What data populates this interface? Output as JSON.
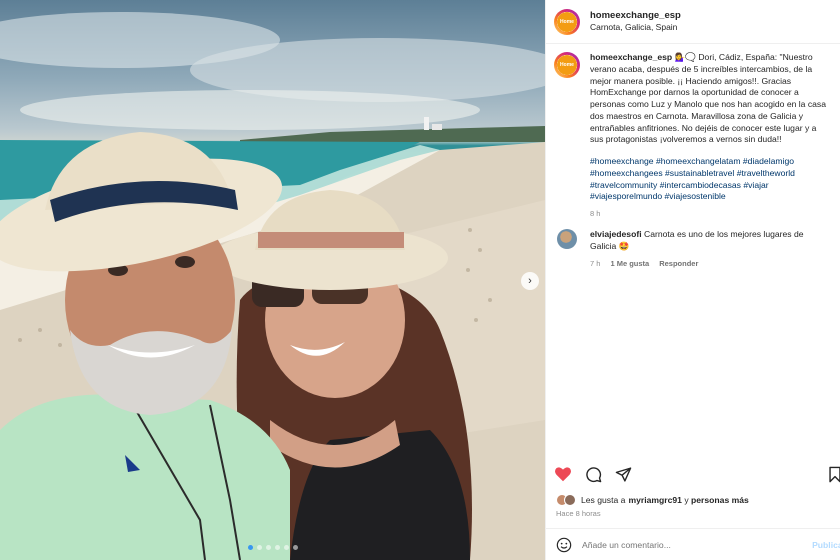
{
  "post": {
    "username": "homeexchange_esp",
    "location": "Carnota, Galicia, Spain",
    "avatar_text": "Home",
    "caption_username": "homeexchange_esp",
    "caption_emoji": "💁‍♀️🗨️",
    "caption_text": " Dori, Cádiz, España: \"Nuestro verano acaba, después de 5 increíbles intercambios, de la mejor manera posible. ¡¡ Haciendo amigos!!. Gracias HomExchange por darnos la oportunidad de conocer a personas como Luz y Manolo que nos han acogido en la casa dos maestros en Carnota. Maravillosa zona de Galicia y entrañables anfitriones. No dejéis de conocer este lugar y a sus protagonistas ¡volveremos a vernos sin duda!!",
    "hashtags": [
      "#homeexchange",
      "#homeexchangelatam",
      "#diadelamigo",
      "#homeexchangees",
      "#sustainabletravel",
      "#traveltheworld",
      "#travelcommunity",
      "#intercambiodecasas",
      "#viajar",
      "#viajesporelmundo",
      "#viajesostenible"
    ],
    "caption_time": "8 h"
  },
  "comments": [
    {
      "username": "elviajedesofi",
      "text": " Carnota es uno de los mejores lugares de Galicia 🤩",
      "time": "7 h",
      "likes": "1 Me gusta",
      "reply": "Responder"
    }
  ],
  "likes": {
    "prefix": "Les gusta a ",
    "user": "myriamgrc91",
    "connector": " y ",
    "rest": "personas más"
  },
  "timestamp": "Hace 8 horas",
  "add_comment": {
    "placeholder": "Añade un comentario...",
    "publish": "Publicar"
  },
  "carousel": {
    "next_icon": "chevron-right-icon",
    "dots": 6,
    "active_index": 0
  },
  "icons": {
    "like": "heart-icon",
    "comment": "comment-icon",
    "share": "paper-plane-icon",
    "save": "bookmark-icon",
    "emoji": "smiley-icon"
  },
  "colors": {
    "liked": "#ed4956",
    "hashtag": "#00376b",
    "muted": "#8e8e8e",
    "active_dot": "#3897f0"
  }
}
